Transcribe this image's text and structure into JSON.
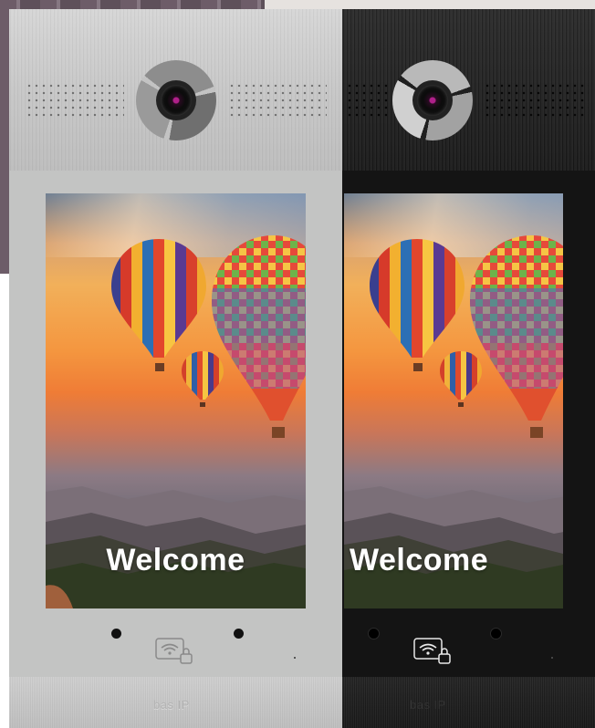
{
  "panels": [
    {
      "id": "silver",
      "finish_color": "#c3c4c3",
      "screen": {
        "welcome_text": "Welcome"
      },
      "brand_text": "bas IP"
    },
    {
      "id": "black",
      "finish_color": "#141414",
      "screen": {
        "welcome_text": "Welcome"
      },
      "brand_text": "bas IP"
    }
  ],
  "icons": {
    "camera": "camera-lens-icon",
    "rfid": "nfc-card-lock-icon",
    "sensor": "proximity-sensor-icon",
    "balloon": "hot-air-balloon-icon"
  },
  "colors": {
    "accent_lens": "#b0208a",
    "welcome_text": "#ffffff"
  }
}
